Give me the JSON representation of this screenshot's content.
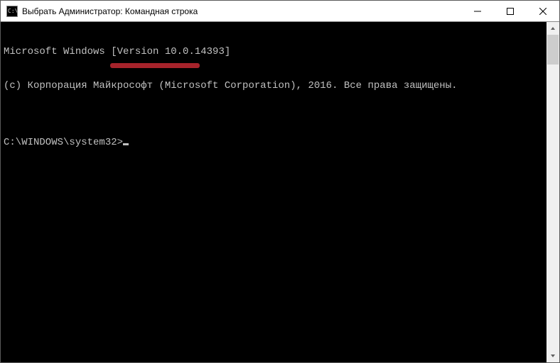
{
  "window": {
    "title": "Выбрать Администратор: Командная строка",
    "icon_text": "C:\\"
  },
  "terminal": {
    "line1": "Microsoft Windows [Version 10.0.14393]",
    "line2": "(c) Корпорация Майкрософт (Microsoft Corporation), 2016. Все права защищены.",
    "blank": "",
    "prompt": "C:\\WINDOWS\\system32>"
  },
  "colors": {
    "underline": "#a6232b",
    "term_fg": "#c0c0c0",
    "term_bg": "#000000"
  }
}
